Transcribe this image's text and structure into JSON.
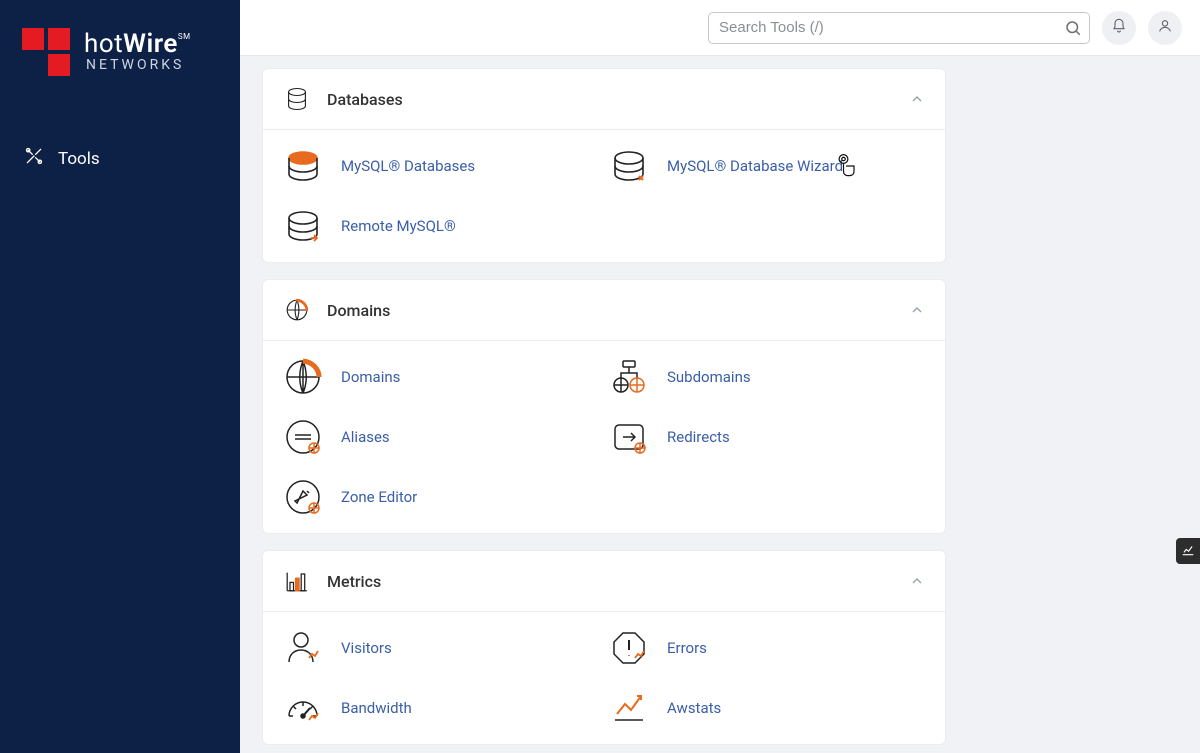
{
  "brand": {
    "name_part1": "hot",
    "name_part2": "Wire",
    "mark": "SM",
    "subtitle": "NETWORKS"
  },
  "sidebar": {
    "items": [
      {
        "label": "Tools"
      }
    ]
  },
  "header": {
    "search_placeholder": "Search Tools (/)"
  },
  "panels": [
    {
      "title": "Databases",
      "items": [
        {
          "label": "MySQL® Databases"
        },
        {
          "label": "MySQL® Database Wizard"
        },
        {
          "label": "Remote MySQL®"
        }
      ]
    },
    {
      "title": "Domains",
      "items": [
        {
          "label": "Domains"
        },
        {
          "label": "Subdomains"
        },
        {
          "label": "Aliases"
        },
        {
          "label": "Redirects"
        },
        {
          "label": "Zone Editor"
        }
      ]
    },
    {
      "title": "Metrics",
      "items": [
        {
          "label": "Visitors"
        },
        {
          "label": "Errors"
        },
        {
          "label": "Bandwidth"
        },
        {
          "label": "Awstats"
        }
      ]
    }
  ]
}
